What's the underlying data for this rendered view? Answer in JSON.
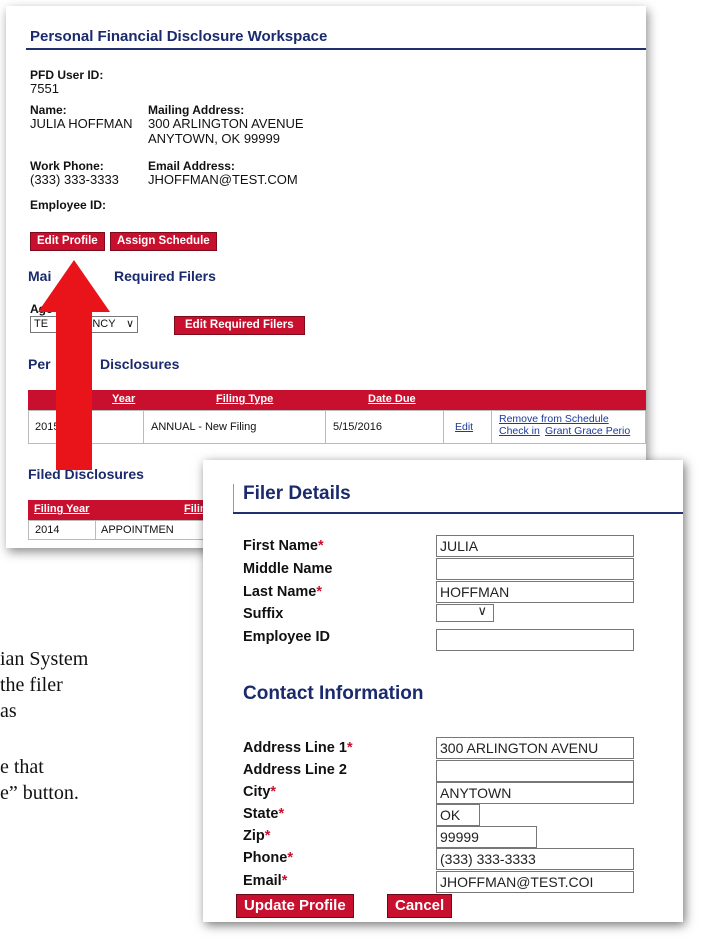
{
  "workspace": {
    "title": "Personal Financial Disclosure Workspace",
    "pfd_user_id_label": "PFD User ID:",
    "pfd_user_id": "7551",
    "name_label": "Name:",
    "name": "JULIA HOFFMAN",
    "mailing_label": "Mailing Address:",
    "mailing_line1": "300 ARLINGTON AVENUE",
    "mailing_line2": "ANYTOWN, OK 99999",
    "work_phone_label": "Work Phone:",
    "work_phone": "(333) 333-3333",
    "email_label": "Email Address:",
    "email": "JHOFFMAN@TEST.COM",
    "employee_id_label": "Employee ID:",
    "edit_profile_label": "Edit Profile",
    "assign_schedule_label": "Assign Schedule",
    "required_filers_heading_start": "Mai",
    "required_filers_heading_end": "Required Filers",
    "agency_label": "Age",
    "agency_select_start": "TE",
    "agency_select_end": "ENCY",
    "edit_required_filers_label": "Edit Required Filers",
    "pending_heading_start": "Per",
    "pending_heading_end": "Disclosures",
    "pending_columns": [
      "Year",
      "Filing Type",
      "Date Due"
    ],
    "pending_row": {
      "year": "2015",
      "filing_type": "ANNUAL - New Filing",
      "date_due": "5/15/2016",
      "edit": "Edit",
      "remove": "Remove from Schedule",
      "check_in": "Check in",
      "grant": "Grant Grace Perio"
    },
    "filed_heading": "Filed Disclosures",
    "filed_columns": [
      "Filing Year",
      "Filin"
    ],
    "filed_row": {
      "year": "2014",
      "type": "APPOINTMEN"
    }
  },
  "background_text": {
    "line1": "ian System",
    "line2": "the filer",
    "line3": "as",
    "line4": "e that",
    "line5": "e” button."
  },
  "filer_details": {
    "title": "Filer Details",
    "first_name_label": "First Name",
    "first_name": "JULIA",
    "middle_name_label": "Middle Name",
    "middle_name": "",
    "last_name_label": "Last Name",
    "last_name": "HOFFMAN",
    "suffix_label": "Suffix",
    "suffix": "",
    "employee_id_label": "Employee ID",
    "employee_id": "",
    "contact_heading": "Contact Information",
    "address1_label": "Address Line 1",
    "address1": "300 ARLINGTON AVENU",
    "address2_label": "Address Line 2",
    "address2": "",
    "city_label": "City",
    "city": "ANYTOWN",
    "state_label": "State",
    "state": "OK",
    "zip_label": "Zip",
    "zip": "99999",
    "phone_label": "Phone",
    "phone": "(333) 333-3333",
    "email_label": "Email",
    "email": "JHOFFMAN@TEST.COI",
    "required_mark": "*",
    "update_label": "Update Profile",
    "cancel_label": "Cancel"
  },
  "colors": {
    "accent_red": "#c8102e",
    "heading_navy": "#1a2a6c"
  }
}
